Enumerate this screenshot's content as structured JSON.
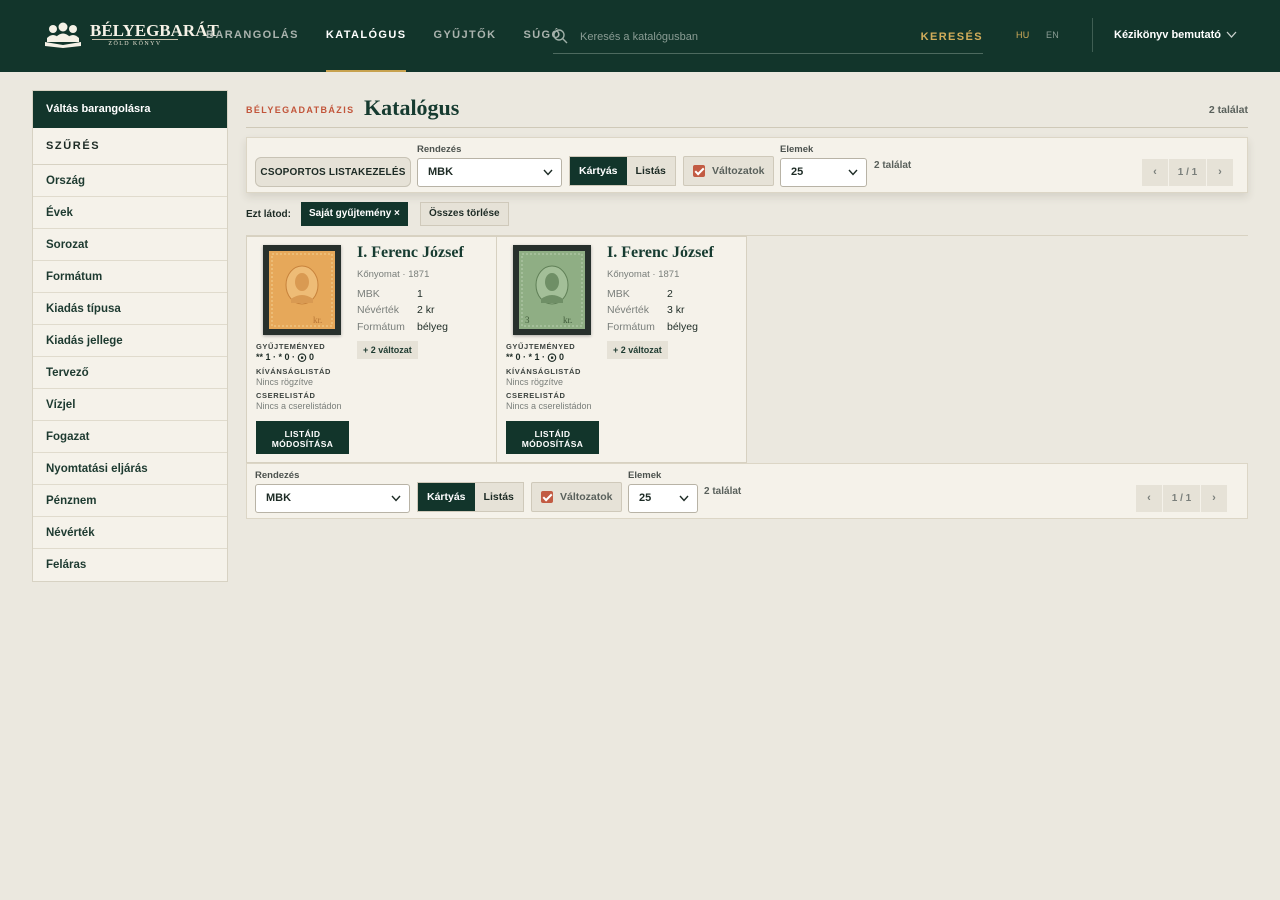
{
  "brand": {
    "name": "BÉLYEGBARÁT",
    "sub": "ZÖLD KÖNYV",
    "colors": {
      "primary": "#12352b",
      "accent_gold": "#c7a24f",
      "accent_red": "#c2553a",
      "background": "#ebe8df"
    }
  },
  "nav": {
    "items": [
      {
        "label": "BARANGOLÁS"
      },
      {
        "label": "KATALÓGUS",
        "active": true
      },
      {
        "label": "GYŰJTŐK"
      },
      {
        "label": "SÚGÓ"
      }
    ]
  },
  "search": {
    "placeholder": "Keresés a katalógusban",
    "button": "KERESÉS",
    "icon": "search-icon"
  },
  "lang": {
    "hu": "HU",
    "en": "EN",
    "active": "HU"
  },
  "manual": {
    "label": "Kézikönyv bemutató",
    "icon": "chevron-down-icon"
  },
  "sidebar": {
    "switch_label": "Váltás barangolásra",
    "filter_title": "SZŰRÉS",
    "items": [
      {
        "label": "Ország"
      },
      {
        "label": "Évek"
      },
      {
        "label": "Sorozat"
      },
      {
        "label": "Formátum"
      },
      {
        "label": "Kiadás típusa"
      },
      {
        "label": "Kiadás jellege"
      },
      {
        "label": "Tervező"
      },
      {
        "label": "Vízjel"
      },
      {
        "label": "Fogazat"
      },
      {
        "label": "Nyomtatási eljárás"
      },
      {
        "label": "Pénznem"
      },
      {
        "label": "Névérték"
      },
      {
        "label": "Feláras"
      }
    ]
  },
  "header": {
    "kicker": "BÉLYEGADATBÁZIS",
    "title": "Katalógus",
    "count": "2 találat"
  },
  "toolbar": {
    "group_button": "CSOPORTOS LISTAKEZELÉS",
    "sort_label": "Rendezés",
    "sort_value": "MBK",
    "view_cards": "Kártyás",
    "view_list": "Listás",
    "active_view": "cards",
    "variants_label": "Változatok",
    "variants_checked": true,
    "items_label": "Elemek",
    "items_value": "25",
    "count": "2 találat",
    "page": "1 / 1",
    "prev": "‹",
    "next": "›"
  },
  "active_filters": {
    "label": "Ezt látod:",
    "chips": [
      {
        "label": "Saját gyűjtemény ×"
      }
    ],
    "clear_label": "Összes törlése"
  },
  "cards": [
    {
      "title": "I. Ferenc József",
      "subtitle": "Kőnyomat · 1871",
      "stamp_color": "#e6a85a",
      "meta": [
        {
          "key": "MBK",
          "value": "1"
        },
        {
          "key": "Névérték",
          "value": "2 kr"
        },
        {
          "key": "Formátum",
          "value": "bélyeg"
        }
      ],
      "variants_badge": "+ 2 változat",
      "collection_label": "GYŰJTEMÉNYED",
      "collection_value": "** 1 · * 0 · ⨀ 0",
      "wishlist_label": "KÍVÁNSÁGLISTÁD",
      "wishlist_value": "Nincs rögzítve",
      "trade_label": "CSERELISTÁD",
      "trade_value": "Nincs a cserelistádon",
      "lists_button_line1": "LISTÁID",
      "lists_button_line2": "MÓDOSÍTÁSA"
    },
    {
      "title": "I. Ferenc József",
      "subtitle": "Kőnyomat · 1871",
      "stamp_color": "#8fae84",
      "meta": [
        {
          "key": "MBK",
          "value": "2"
        },
        {
          "key": "Névérték",
          "value": "3 kr"
        },
        {
          "key": "Formátum",
          "value": "bélyeg"
        }
      ],
      "variants_badge": "+ 2 változat",
      "collection_label": "GYŰJTEMÉNYED",
      "collection_value": "** 0 · * 1 · ⨀ 0",
      "wishlist_label": "KÍVÁNSÁGLISTÁD",
      "wishlist_value": "Nincs rögzítve",
      "trade_label": "CSERELISTÁD",
      "trade_value": "Nincs a cserelistádon",
      "lists_button_line1": "LISTÁID",
      "lists_button_line2": "MÓDOSÍTÁSA"
    }
  ]
}
